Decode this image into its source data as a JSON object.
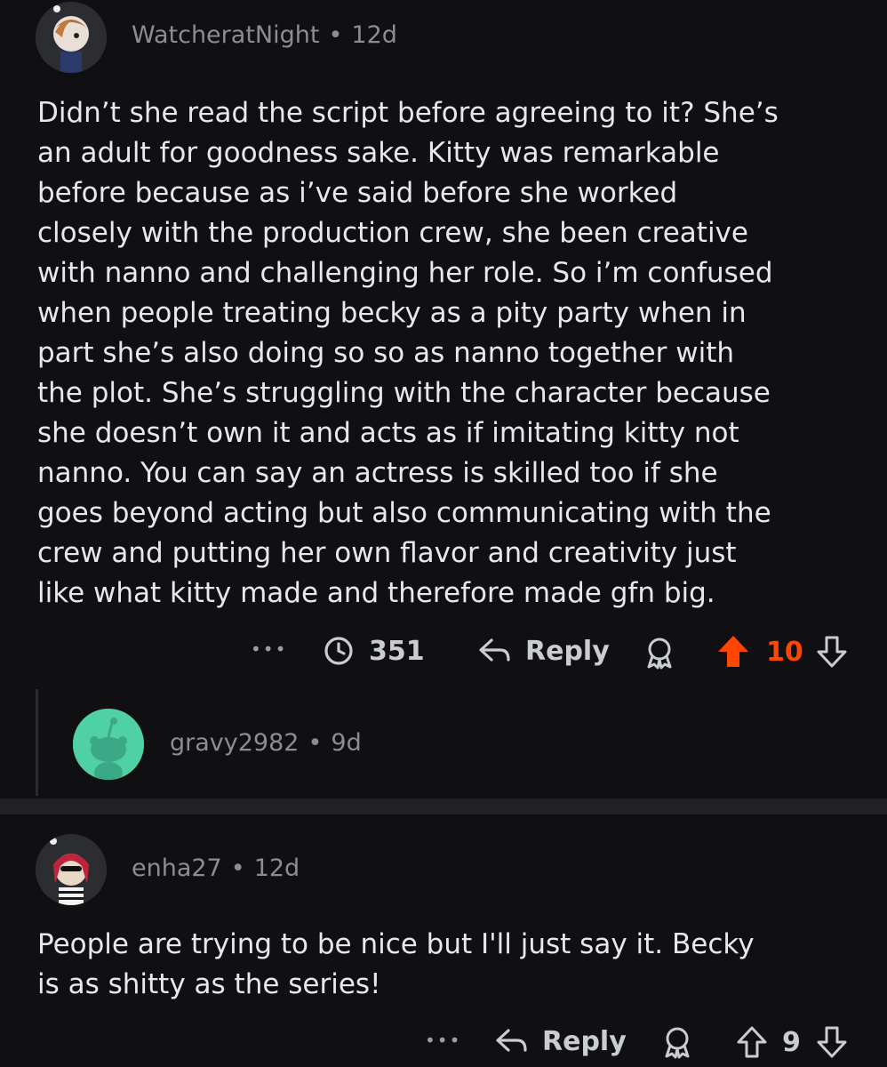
{
  "comments": [
    {
      "username": "WatcheratNight",
      "time": "12d",
      "body_lines": [
        "Didn’t she read the script before agreeing to it? She’s",
        "an adult for goodness sake. Kitty was remarkable",
        "before because as i’ve said before she worked",
        "closely with the production crew, she been creative",
        "with nanno and challenging her role. So i’m confused",
        "when people treating becky as a pity party when in",
        "part she’s also doing so so as nanno together with",
        "the plot. She’s struggling with the character because",
        "she doesn’t own it and acts as if imitating kitty not",
        "nanno. You can say an actress is skilled too if she",
        "goes beyond acting but also communicating with the",
        "crew and putting her own flavor and creativity just",
        "like what kitty made and therefore made gfn big."
      ],
      "more_label": "•••",
      "views": "351",
      "reply_label": "Reply",
      "votes": "10"
    },
    {
      "username": "gravy2982",
      "time": "9d"
    },
    {
      "username": "enha27",
      "time": "12d",
      "body_lines": [
        "People are trying to be nice but I'll just say it. Becky",
        "is as shitty as the series!"
      ],
      "more_label": "•••",
      "reply_label": "Reply",
      "votes": "9"
    }
  ],
  "colors": {
    "background": "#101012",
    "upvote_active": "#ff4500",
    "muted": "#9a9da2",
    "avatar_default": "#4fd1a5"
  }
}
